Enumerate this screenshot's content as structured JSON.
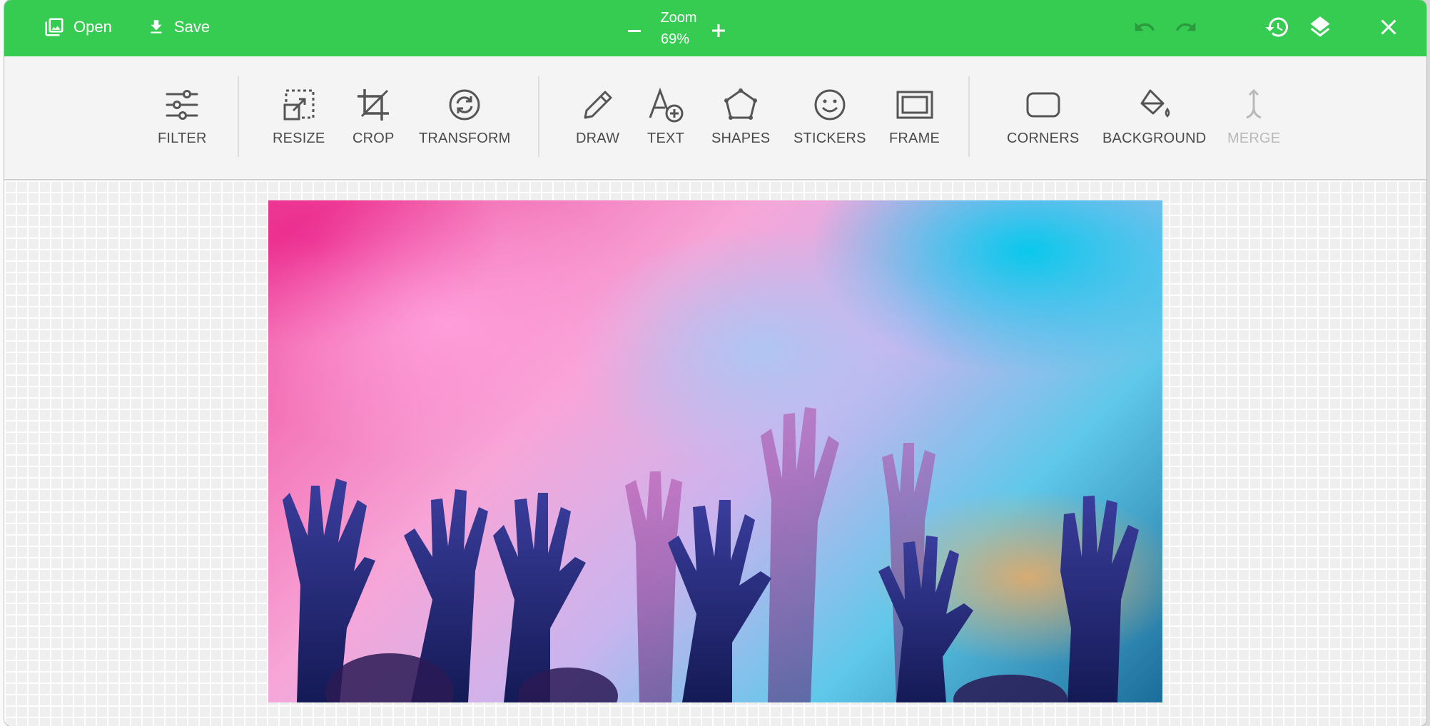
{
  "topbar": {
    "open_label": "Open",
    "save_label": "Save",
    "zoom_title": "Zoom",
    "zoom_value": "69%",
    "icons": {
      "open": "image-icon",
      "save": "download-icon",
      "zoom_out": "minus-icon",
      "zoom_in": "plus-icon",
      "undo": "undo-icon",
      "redo": "redo-icon",
      "history": "history-icon",
      "layers": "layers-icon",
      "close": "close-icon"
    }
  },
  "tools": [
    {
      "key": "filter",
      "label": "FILTER",
      "icon": "sliders-icon"
    },
    {
      "key": "resize",
      "label": "RESIZE",
      "icon": "resize-icon"
    },
    {
      "key": "crop",
      "label": "CROP",
      "icon": "crop-icon"
    },
    {
      "key": "transform",
      "label": "TRANSFORM",
      "icon": "rotate-icon"
    },
    {
      "key": "draw",
      "label": "DRAW",
      "icon": "pencil-icon"
    },
    {
      "key": "text",
      "label": "TEXT",
      "icon": "text-add-icon"
    },
    {
      "key": "shapes",
      "label": "SHAPES",
      "icon": "pentagon-icon"
    },
    {
      "key": "stickers",
      "label": "STICKERS",
      "icon": "smiley-icon"
    },
    {
      "key": "frame",
      "label": "FRAME",
      "icon": "frame-icon"
    },
    {
      "key": "corners",
      "label": "CORNERS",
      "icon": "rounded-rect-icon"
    },
    {
      "key": "background",
      "label": "BACKGROUND",
      "icon": "paint-bucket-icon"
    },
    {
      "key": "merge",
      "label": "MERGE",
      "icon": "merge-icon",
      "disabled": true
    }
  ],
  "colors": {
    "topbar": "#36cc52",
    "tool_label": "#4a4a4a",
    "disabled": "#b9b9b9"
  },
  "canvas": {
    "image_description_icon": "photo-image"
  }
}
